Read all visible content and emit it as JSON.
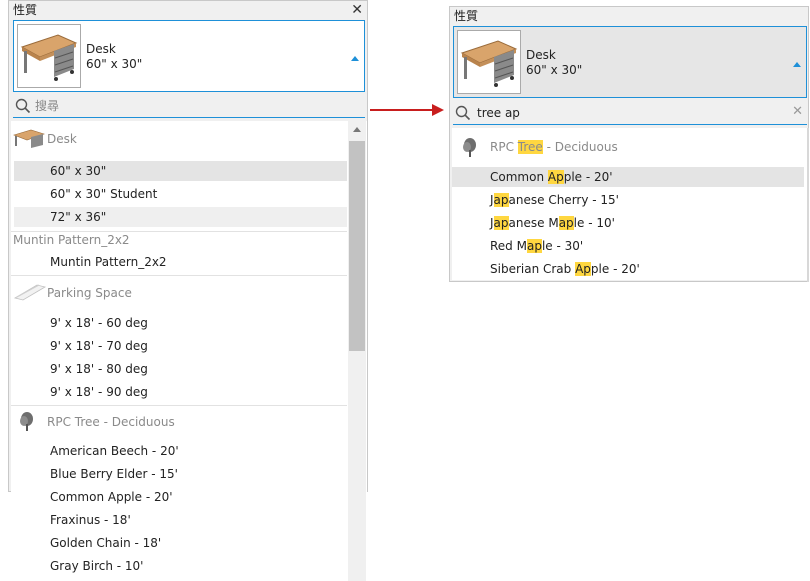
{
  "left_panel": {
    "title": "性質",
    "selected_type": {
      "name": "Desk",
      "size": "60\" x 30\""
    },
    "search": {
      "placeholder": "搜尋",
      "value": ""
    },
    "categories": [
      {
        "name": "Desk",
        "icon": "desk-icon",
        "items": [
          "60\" x 30\"",
          "60\" x 30\" Student",
          "72\" x 36\""
        ]
      },
      {
        "name": "Muntin Pattern_2x2",
        "icon": "",
        "items": [
          "Muntin Pattern_2x2"
        ]
      },
      {
        "name": "Parking Space",
        "icon": "parking-space-icon",
        "items": [
          "9' x 18' - 60 deg",
          "9' x 18' - 70 deg",
          "9' x 18' - 80 deg",
          "9' x 18' - 90 deg"
        ]
      },
      {
        "name": "RPC Tree - Deciduous",
        "icon": "tree-icon",
        "items": [
          "American Beech - 20'",
          "Blue Berry Elder - 15'",
          "Common Apple - 20'",
          "Fraxinus - 18'",
          "Golden Chain - 18'",
          "Gray Birch - 10'"
        ]
      }
    ]
  },
  "right_panel": {
    "title": "性質",
    "selected_type": {
      "name": "Desk",
      "size": "60\" x 30\""
    },
    "search": {
      "value": "tree ap"
    },
    "category": {
      "name_parts": [
        "RPC ",
        "Tree",
        " - Deciduous"
      ],
      "icon": "tree-icon"
    },
    "results": [
      {
        "parts": [
          "Common ",
          "Ap",
          "ple - 20'"
        ]
      },
      {
        "parts": [
          "J",
          "ap",
          "anese Cherry - 15'"
        ]
      },
      {
        "parts": [
          "J",
          "ap",
          "anese M",
          "ap",
          "le - 10'"
        ]
      },
      {
        "parts": [
          "Red M",
          "ap",
          "le - 30'"
        ]
      },
      {
        "parts": [
          "Siberian Crab ",
          "Ap",
          "ple - 20'"
        ]
      }
    ]
  },
  "colors": {
    "accent": "#1e90d8",
    "highlight": "#ffd740",
    "arrow": "#c81e1e"
  }
}
